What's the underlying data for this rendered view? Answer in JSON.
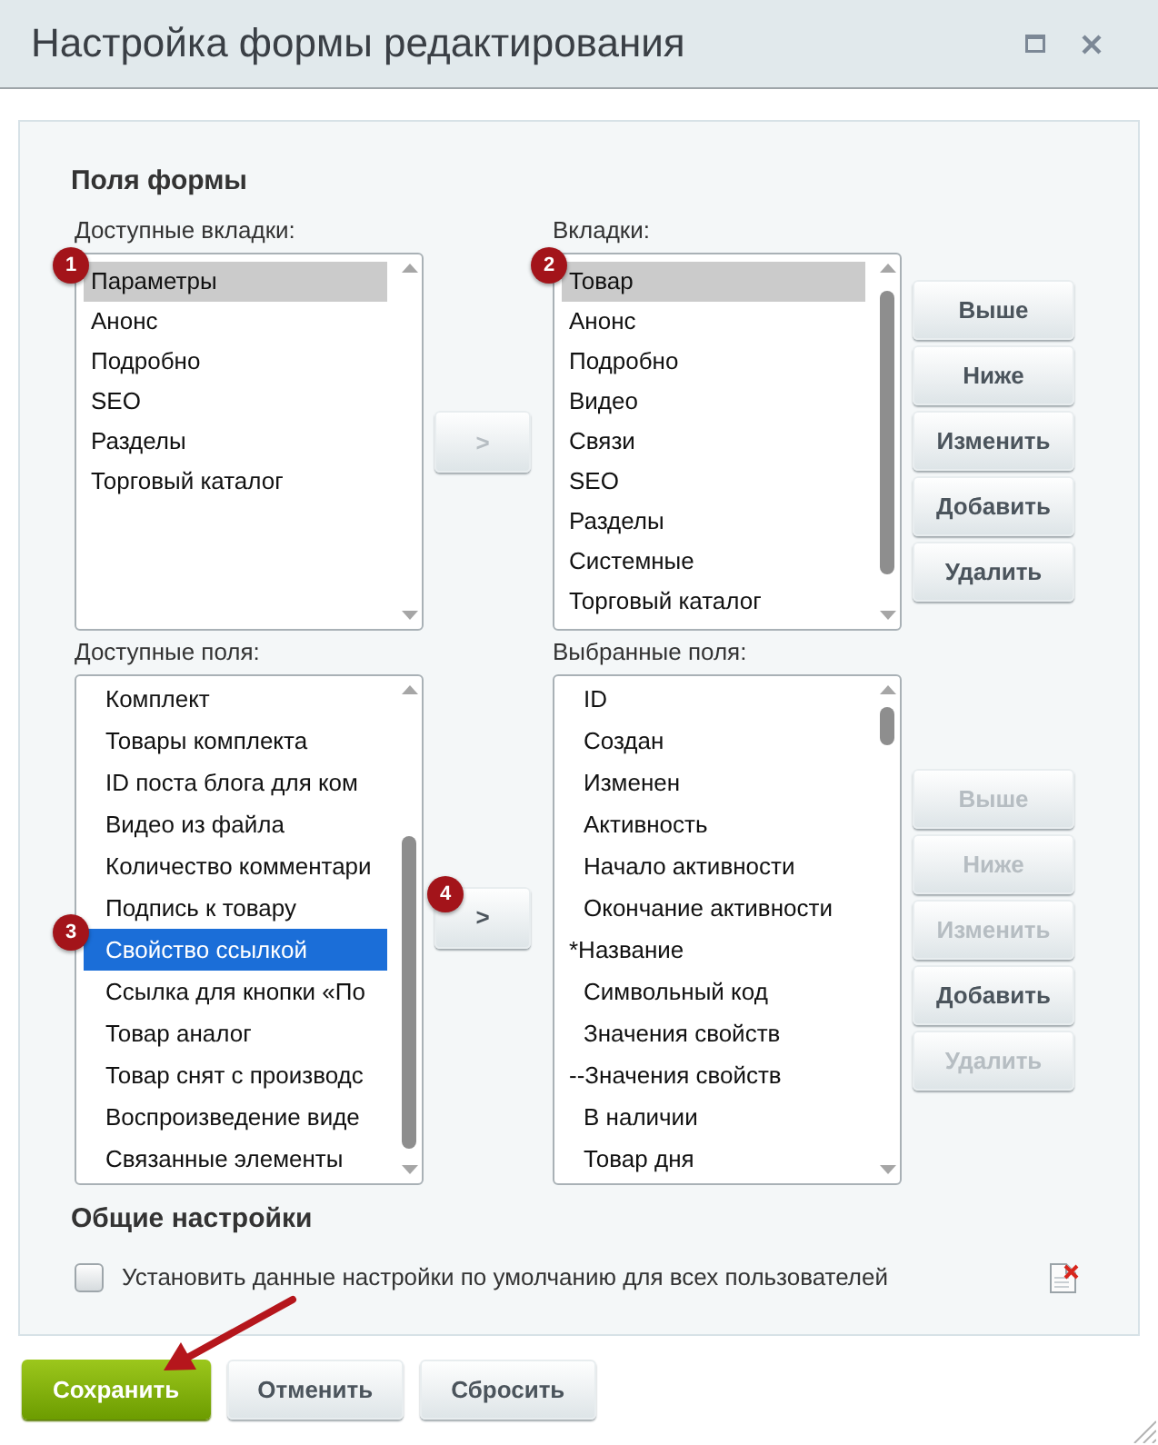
{
  "window": {
    "title": "Настройка формы редактирования"
  },
  "form_fields": {
    "heading": "Поля формы",
    "groups": [
      {
        "left": {
          "label": "Доступные вкладки:",
          "focused": false,
          "items": [
            {
              "text": "Параметры",
              "selected": true,
              "badge": "1"
            },
            {
              "text": "Анонс",
              "selected": false
            },
            {
              "text": "Подробно",
              "selected": false
            },
            {
              "text": "SEO",
              "selected": false
            },
            {
              "text": "Разделы",
              "selected": false
            },
            {
              "text": "Торговый каталог",
              "selected": false
            }
          ]
        },
        "move": {
          "label": ">",
          "disabled": true
        },
        "right": {
          "label": "Вкладки:",
          "focused": false,
          "items": [
            {
              "text": "Товар",
              "selected": true,
              "badge": "2"
            },
            {
              "text": "Анонс",
              "selected": false
            },
            {
              "text": "Подробно",
              "selected": false
            },
            {
              "text": "Видео",
              "selected": false
            },
            {
              "text": "Связи",
              "selected": false
            },
            {
              "text": "SEO",
              "selected": false
            },
            {
              "text": "Разделы",
              "selected": false
            },
            {
              "text": "Системные",
              "selected": false
            },
            {
              "text": "Торговый каталог",
              "selected": false
            }
          ]
        },
        "buttons": [
          {
            "label": "Выше",
            "disabled": false
          },
          {
            "label": "Ниже",
            "disabled": false
          },
          {
            "label": "Изменить",
            "disabled": false
          },
          {
            "label": "Добавить",
            "disabled": false
          },
          {
            "label": "Удалить",
            "disabled": false
          }
        ]
      },
      {
        "left": {
          "label": "Доступные поля:",
          "focused": true,
          "items": [
            {
              "text": "Комплект",
              "selected": false,
              "indented": true
            },
            {
              "text": "Товары комплекта",
              "selected": false,
              "indented": true
            },
            {
              "text": "ID поста блога для ком",
              "selected": false,
              "indented": true
            },
            {
              "text": "Видео из файла",
              "selected": false,
              "indented": true
            },
            {
              "text": "Количество комментари",
              "selected": false,
              "indented": true
            },
            {
              "text": "Подпись к товару",
              "selected": false,
              "indented": true
            },
            {
              "text": "Свойство ссылкой",
              "selected": true,
              "indented": true,
              "badge": "3"
            },
            {
              "text": "Ссылка для кнопки «По",
              "selected": false,
              "indented": true
            },
            {
              "text": "Товар аналог",
              "selected": false,
              "indented": true
            },
            {
              "text": "Товар снят с производс",
              "selected": false,
              "indented": true
            },
            {
              "text": "Воспроизведение виде",
              "selected": false,
              "indented": true
            },
            {
              "text": "Связанные элементы",
              "selected": false,
              "indented": true
            }
          ]
        },
        "move": {
          "label": ">",
          "disabled": false,
          "badge": "4"
        },
        "right": {
          "label": "Выбранные поля:",
          "items": [
            {
              "text": "ID",
              "selected": false,
              "indented": true
            },
            {
              "text": "Создан",
              "selected": false,
              "indented": true
            },
            {
              "text": "Изменен",
              "selected": false,
              "indented": true
            },
            {
              "text": "Активность",
              "selected": false,
              "indented": true
            },
            {
              "text": "Начало активности",
              "selected": false,
              "indented": true
            },
            {
              "text": "Окончание активности",
              "selected": false,
              "indented": true
            },
            {
              "text": "*Название",
              "selected": false,
              "indented": false
            },
            {
              "text": "Символьный код",
              "selected": false,
              "indented": true
            },
            {
              "text": "Значения свойств",
              "selected": false,
              "indented": true
            },
            {
              "text": "--Значения свойств",
              "selected": false,
              "indented": false
            },
            {
              "text": "В наличии",
              "selected": false,
              "indented": true
            },
            {
              "text": "Товар дня",
              "selected": false,
              "indented": true
            }
          ]
        },
        "buttons": [
          {
            "label": "Выше",
            "disabled": true
          },
          {
            "label": "Ниже",
            "disabled": true
          },
          {
            "label": "Изменить",
            "disabled": true
          },
          {
            "label": "Добавить",
            "disabled": false
          },
          {
            "label": "Удалить",
            "disabled": true
          }
        ]
      }
    ]
  },
  "general": {
    "heading": "Общие настройки",
    "checkbox": {
      "label": "Установить данные настройки по умолчанию для всех пользователей",
      "checked": false
    }
  },
  "footer_buttons": [
    {
      "label": "Сохранить",
      "kind": "primary"
    },
    {
      "label": "Отменить",
      "kind": "default"
    },
    {
      "label": "Сбросить",
      "kind": "default"
    }
  ]
}
